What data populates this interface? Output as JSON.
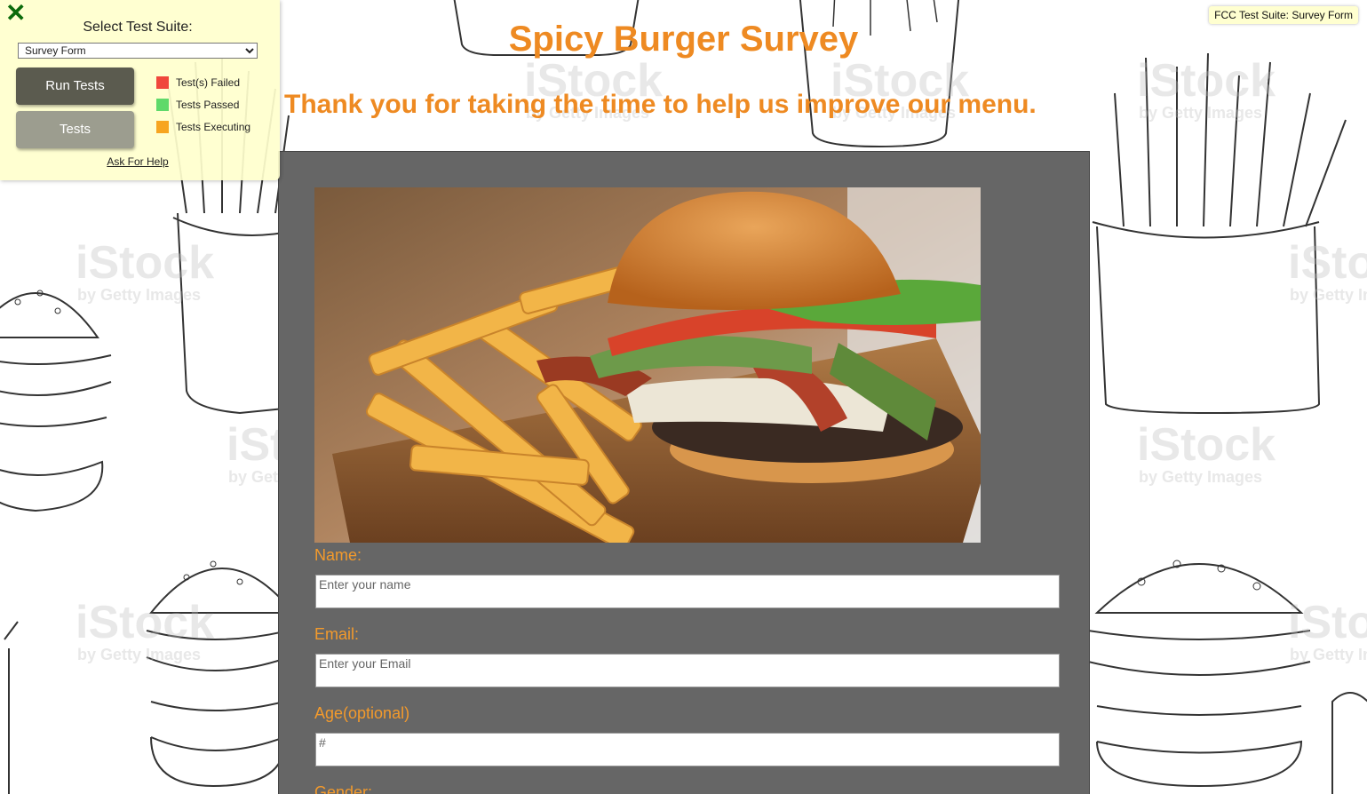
{
  "page": {
    "title": "Spicy Burger Survey",
    "subtitle": "Thank you for taking the time to help us improve our menu."
  },
  "form": {
    "image_alt": "burger-and-fries-photo",
    "fields": [
      {
        "label": "Name:",
        "placeholder": "Enter your name",
        "value": ""
      },
      {
        "label": "Email:",
        "placeholder": "Enter your Email",
        "value": ""
      },
      {
        "label": "Age(optional)",
        "placeholder": "#",
        "value": ""
      }
    ],
    "next_label_partial": "Gender:"
  },
  "fcc": {
    "close_icon": "close-x-icon",
    "select_title": "Select Test Suite:",
    "selected_suite": "Survey Form",
    "run_tests_label": "Run Tests",
    "tests_label": "Tests",
    "legend": [
      {
        "label": "Test(s) Failed",
        "color": "#f0473c"
      },
      {
        "label": "Tests Passed",
        "color": "#5fd96a"
      },
      {
        "label": "Tests Executing",
        "color": "#f7a520"
      }
    ],
    "help_label": "Ask For Help",
    "suite_tag": "FCC Test Suite: Survey Form"
  },
  "watermark": {
    "brand": "iStock",
    "tagline": "by Getty Images"
  },
  "colors": {
    "accent": "#ee8a22",
    "panel": "#666666",
    "fcc_bg": "#ffffcd"
  }
}
